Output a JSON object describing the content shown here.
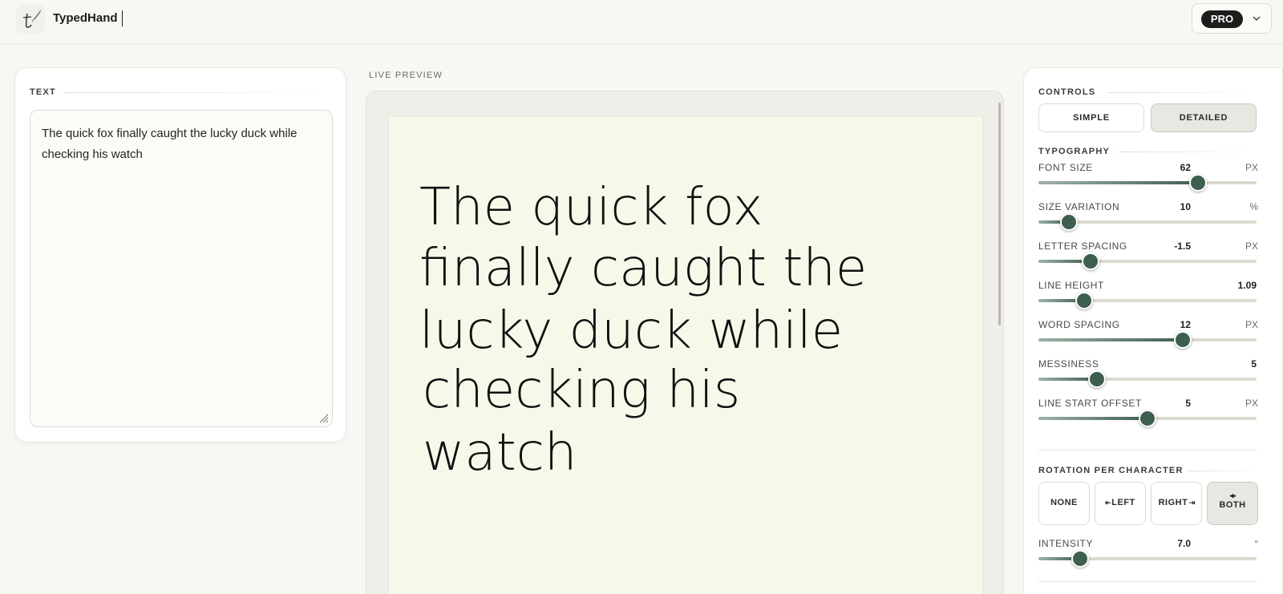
{
  "header": {
    "app_name": "TypedHand",
    "plan_badge": "PRO"
  },
  "text_panel": {
    "section_label": "TEXT",
    "content": "The quick fox finally caught the lucky duck while checking his watch"
  },
  "preview": {
    "section_label": "LIVE PREVIEW",
    "handwritten_lines": [
      "The quick fox",
      "finally caught the",
      "lucky duck while",
      "checking his",
      "watch"
    ]
  },
  "controls": {
    "section_label": "CONTROLS",
    "modes": {
      "simple": "SIMPLE",
      "detailed": "DETAILED",
      "selected": "DETAILED"
    },
    "typography_label": "TYPOGRAPHY",
    "sliders": [
      {
        "id": "font-size",
        "label": "FONT SIZE",
        "value": "62",
        "unit": "PX",
        "level": 0.73
      },
      {
        "id": "size-variation",
        "label": "SIZE VARIATION",
        "value": "10",
        "unit": "%",
        "level": 0.14
      },
      {
        "id": "letter-spacing",
        "label": "LETTER SPACING",
        "value": "-1.5",
        "unit": "PX",
        "level": 0.24
      },
      {
        "id": "line-height",
        "label": "LINE HEIGHT",
        "value": "1.09",
        "unit": "",
        "level": 0.21
      },
      {
        "id": "word-spacing",
        "label": "WORD SPACING",
        "value": "12",
        "unit": "PX",
        "level": 0.66
      },
      {
        "id": "messiness",
        "label": "MESSINESS",
        "value": "5",
        "unit": "",
        "level": 0.27
      },
      {
        "id": "line-start-offset",
        "label": "LINE START OFFSET",
        "value": "5",
        "unit": "PX",
        "level": 0.5
      }
    ],
    "rotation_label": "ROTATION PER CHARACTER",
    "rotation_options": {
      "none": "NONE",
      "left": "LEFT",
      "right": "RIGHT",
      "both": "BOTH",
      "selected": "BOTH"
    },
    "intensity": {
      "label": "INTENSITY",
      "value": "7.0",
      "unit": "°",
      "level": 0.19
    }
  },
  "colors": {
    "accent": "#3e5e4e",
    "paper": "#f8f8ea",
    "badge": "#1d1d1b"
  }
}
